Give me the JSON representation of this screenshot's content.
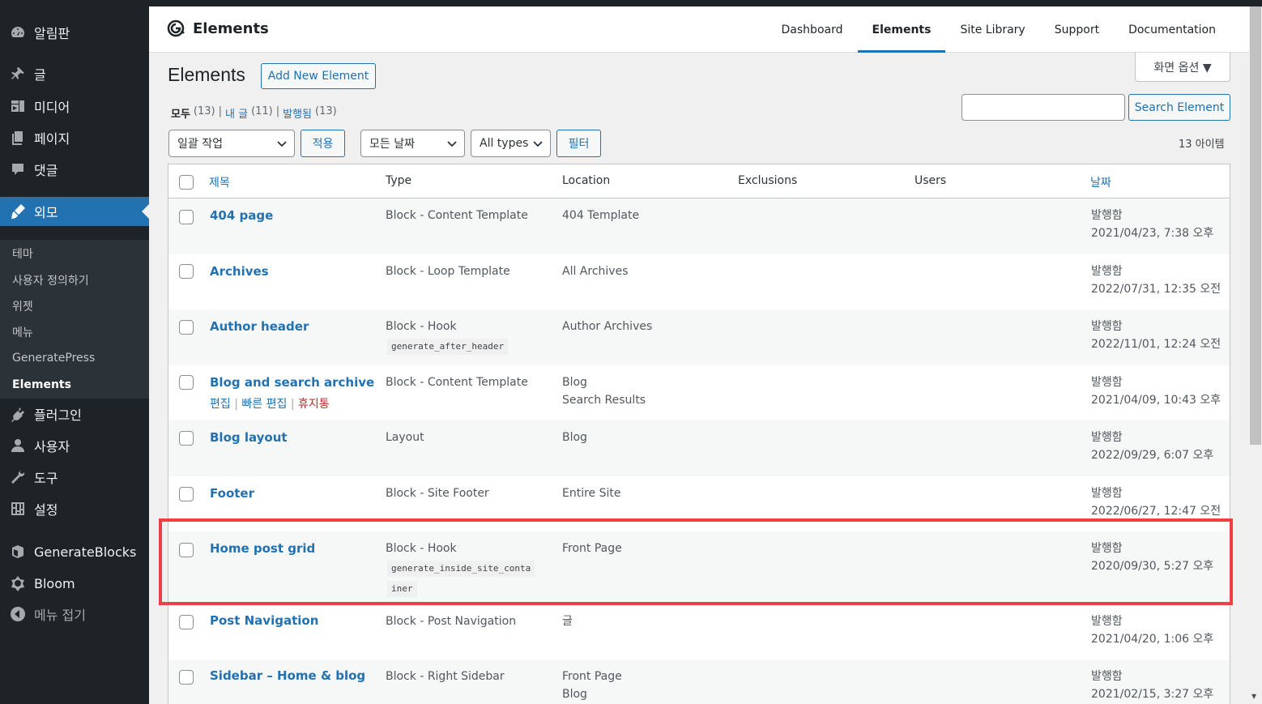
{
  "sidebar": {
    "dashboard": "알림판",
    "posts": "글",
    "media": "미디어",
    "pages": "페이지",
    "comments": "댓글",
    "appearance": "외모",
    "appearance_submenu": [
      "테마",
      "사용자 정의하기",
      "위젯",
      "메뉴",
      "GeneratePress",
      "Elements"
    ],
    "plugins": "플러그인",
    "users": "사용자",
    "tools": "도구",
    "settings": "설정",
    "generateblocks": "GenerateBlocks",
    "bloom": "Bloom",
    "collapse": "메뉴 접기"
  },
  "header": {
    "brand": "Elements",
    "tabs": [
      "Dashboard",
      "Elements",
      "Site Library",
      "Support",
      "Documentation"
    ]
  },
  "page": {
    "title": "Elements",
    "add_new": "Add New Element",
    "screen_options": "화면 옵션 ▼",
    "filters": {
      "all_label": "모두",
      "all_count": "(13)",
      "mine_label": "내 글",
      "mine_count": "(11)",
      "published_label": "발행됨",
      "published_count": "(13)",
      "sep": "|"
    },
    "search_button": "Search Element",
    "bulk_action": "일괄 작업",
    "apply": "적용",
    "all_dates": "모든 날짜",
    "all_types": "All types",
    "filter": "필터",
    "item_count": "13 아이템"
  },
  "table": {
    "headers": {
      "title": "제목",
      "type": "Type",
      "location": "Location",
      "exclusions": "Exclusions",
      "users": "Users",
      "date": "날짜"
    },
    "rows": [
      {
        "title": "404 page",
        "type": "Block - Content Template",
        "hook": "",
        "location": "404 Template",
        "location2": "",
        "status": "발행함",
        "date": "2021/04/23, 7:38 오후"
      },
      {
        "title": "Archives",
        "type": "Block - Loop Template",
        "hook": "",
        "location": "All Archives",
        "location2": "",
        "status": "발행함",
        "date": "2022/07/31, 12:35 오전"
      },
      {
        "title": "Author header",
        "type": "Block - Hook",
        "hook": "generate_after_header",
        "location": "Author Archives",
        "location2": "",
        "status": "발행함",
        "date": "2022/11/01, 12:24 오전"
      },
      {
        "title": "Blog and search archive",
        "type": "Block - Content Template",
        "hook": "",
        "location": "Blog",
        "location2": "Search Results",
        "status": "발행함",
        "date": "2021/04/09, 10:43 오후"
      },
      {
        "title": "Blog layout",
        "type": "Layout",
        "hook": "",
        "location": "Blog",
        "location2": "",
        "status": "발행함",
        "date": "2022/09/29, 6:07 오후"
      },
      {
        "title": "Footer",
        "type": "Block - Site Footer",
        "hook": "",
        "location": "Entire Site",
        "location2": "",
        "status": "발행함",
        "date": "2022/06/27, 12:47 오전"
      },
      {
        "title": "Home post grid",
        "type": "Block - Hook",
        "hook": "generate_inside_site_conta",
        "hook2": "iner",
        "location": "Front Page",
        "location2": "",
        "status": "발행함",
        "date": "2020/09/30, 5:27 오후"
      },
      {
        "title": "Post Navigation",
        "type": "Block - Post Navigation",
        "hook": "",
        "location": "글",
        "location2": "",
        "status": "발행함",
        "date": "2021/04/20, 1:06 오후"
      },
      {
        "title": "Sidebar – Home & blog",
        "type": "Block - Right Sidebar",
        "hook": "",
        "location": "Front Page",
        "location2": "Blog",
        "status": "발행함",
        "date": "2021/02/15, 3:27 오후"
      }
    ],
    "row_actions": {
      "edit": "편집",
      "quick_edit": "빠른 편집",
      "trash": "휴지통",
      "sep": "|"
    }
  },
  "colors": {
    "accent": "#2271b1",
    "highlight": "#f03e45",
    "sidebar": "#1d2327"
  }
}
